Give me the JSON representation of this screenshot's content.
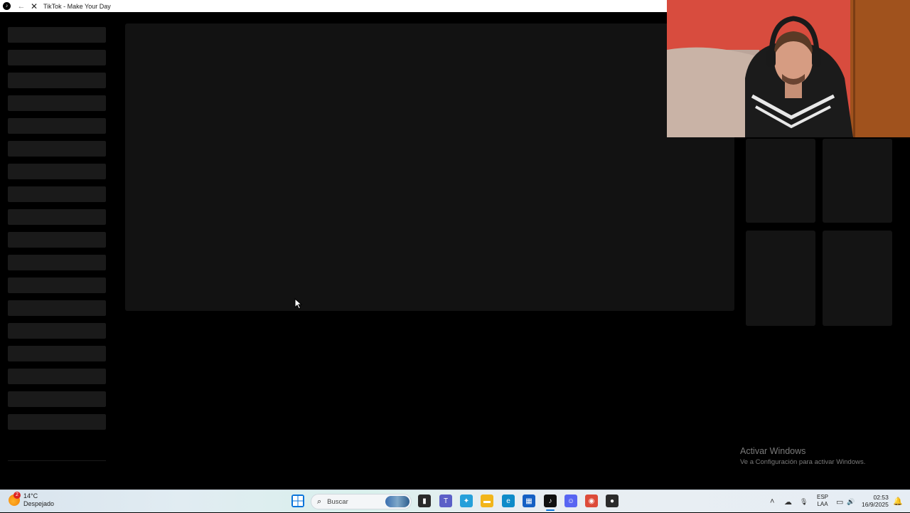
{
  "window": {
    "title": "TikTok - Make Your Day",
    "app_icon": "tiktok-icon",
    "app_icon_glyph": "♪"
  },
  "nav": {
    "back_glyph": "←",
    "stop_glyph": "✕"
  },
  "cursor": {
    "icon": "mouse-pointer-icon"
  },
  "activation": {
    "title": "Activar Windows",
    "subtitle": "Ve a Configuración para activar Windows."
  },
  "taskbar": {
    "weather": {
      "temp": "14°C",
      "condition": "Despejado",
      "badge": "2"
    },
    "search": {
      "placeholder": "Buscar",
      "glyph": "⌕"
    },
    "pinned": [
      {
        "name": "start-button",
        "glyph": "⊞",
        "color": "#0a74da"
      },
      {
        "name": "task-view-button",
        "glyph": "▮",
        "color": "#2a2a2a"
      },
      {
        "name": "teams-button",
        "glyph": "T",
        "color": "#5b5fc7"
      },
      {
        "name": "copilot-button",
        "glyph": "✦",
        "color": "#26a0da"
      },
      {
        "name": "file-explorer-button",
        "glyph": "▬",
        "color": "#f2b51b"
      },
      {
        "name": "edge-button",
        "glyph": "e",
        "color": "#0f8bc9"
      },
      {
        "name": "store-button",
        "glyph": "▦",
        "color": "#1660c4"
      },
      {
        "name": "tiktok-button",
        "glyph": "♪",
        "color": "#111111"
      },
      {
        "name": "discord-button",
        "glyph": "☺",
        "color": "#5865f2"
      },
      {
        "name": "chrome-button",
        "glyph": "◉",
        "color": "#dd4b39"
      },
      {
        "name": "obs-button",
        "glyph": "●",
        "color": "#2b2b2b"
      }
    ],
    "tray": {
      "chevron": "˄",
      "onedrive": "☁",
      "mic": "🎙",
      "language_line1": "ESP",
      "language_line2": "LAA",
      "network": "▭",
      "volume": "🔊",
      "time": "02:53",
      "date": "16/9/2025",
      "bell": "🔔"
    }
  },
  "colors": {
    "skeleton": "#1a1a1a",
    "main_panel": "#121212",
    "webcam_wall": "#d84c3e"
  }
}
